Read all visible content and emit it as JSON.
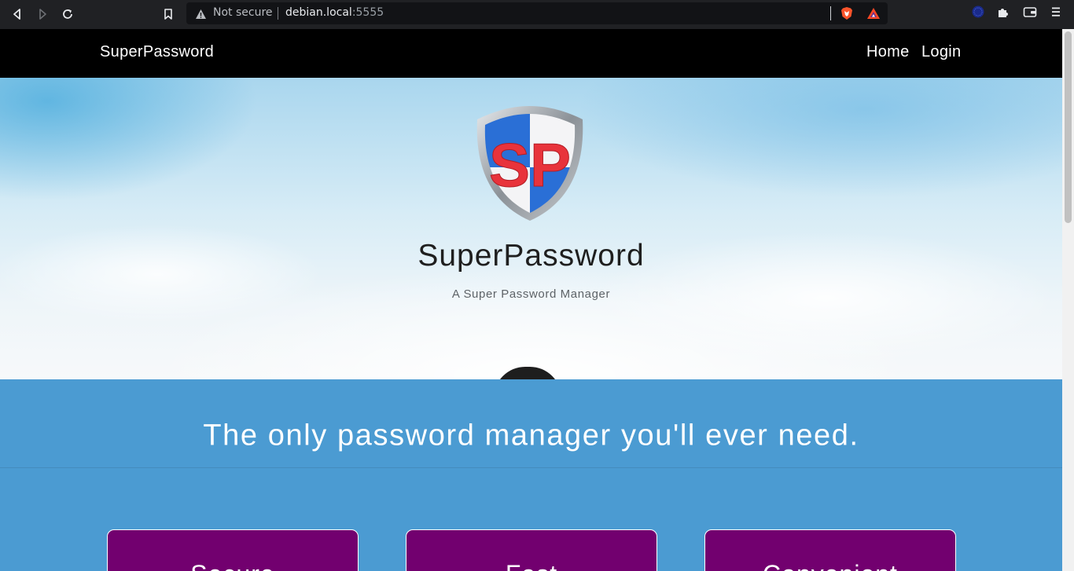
{
  "browser": {
    "security_label": "Not secure",
    "url_host": "debian.local",
    "url_port": ":5555",
    "icons": [
      "back-icon",
      "forward-icon",
      "reload-icon",
      "bookmark-icon",
      "warning-icon",
      "brave-shields-icon",
      "brave-rewards-icon",
      "profile-icon",
      "extensions-icon",
      "wallet-icon",
      "menu-icon"
    ]
  },
  "nav": {
    "brand": "SuperPassword",
    "links": [
      {
        "label": "Home"
      },
      {
        "label": "Login"
      }
    ]
  },
  "hero": {
    "logo_text": "SP",
    "title": "SuperPassword",
    "subtitle": "A Super Password Manager"
  },
  "band": {
    "tagline": "The only password manager you'll ever need."
  },
  "features": {
    "cards": [
      {
        "title": "Secure"
      },
      {
        "title": "Fast"
      },
      {
        "title": "Convenient"
      }
    ]
  },
  "colors": {
    "nav_bg": "#000000",
    "band_bg": "#4b9bd2",
    "card_bg": "#72006f",
    "logo_red": "#e8333b",
    "logo_blue": "#2a6fd6"
  }
}
